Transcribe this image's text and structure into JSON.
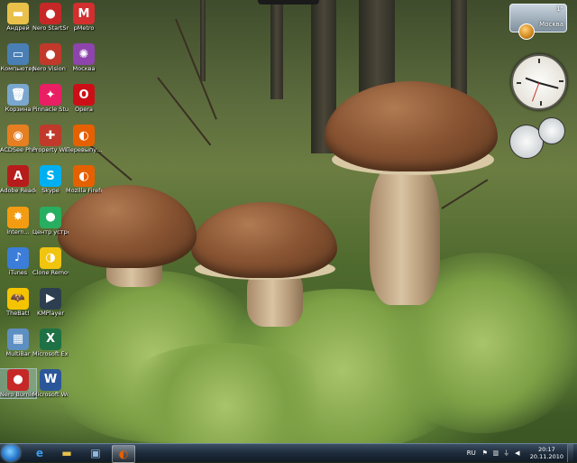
{
  "desktop_icons": [
    {
      "label": "Андрей",
      "icon": "folder-icon",
      "color": "#e8c04a",
      "glyph": "▬"
    },
    {
      "label": "Nero StartSmart 10",
      "icon": "nero-icon",
      "color": "#c62828",
      "glyph": "●"
    },
    {
      "label": "pMetro",
      "icon": "pmetro-icon",
      "color": "#d32f2f",
      "glyph": "M"
    },
    {
      "label": "Компьютер",
      "icon": "computer-icon",
      "color": "#4a7fb5",
      "glyph": "▭"
    },
    {
      "label": "Nero Vision 10",
      "icon": "nero-vision-icon",
      "color": "#c0392b",
      "glyph": "●"
    },
    {
      "label": "Москва",
      "icon": "moscow-icon",
      "color": "#8e44ad",
      "glyph": "✺"
    },
    {
      "label": "Корзина",
      "icon": "recycle-bin-icon",
      "color": "#7aa7cf",
      "glyph": "🗑"
    },
    {
      "label": "Pinnacle Studio 14",
      "icon": "pinnacle-icon",
      "color": "#e91e63",
      "glyph": "✦"
    },
    {
      "label": "Opera",
      "icon": "opera-icon",
      "color": "#cc0f16",
      "glyph": "O"
    },
    {
      "label": "ACDSee Photo Ma...",
      "icon": "acdsee-icon",
      "color": "#e67e22",
      "glyph": "◉"
    },
    {
      "label": "Property Wizard",
      "icon": "wizard-icon",
      "color": "#c0392b",
      "glyph": "✚"
    },
    {
      "label": "Перевыпу...",
      "icon": "firefox-icon",
      "color": "#e66000",
      "glyph": "◐"
    },
    {
      "label": "Adobe Reader X",
      "icon": "adobe-reader-icon",
      "color": "#b71c1c",
      "glyph": "A"
    },
    {
      "label": "Skype",
      "icon": "skype-icon",
      "color": "#00aff0",
      "glyph": "S"
    },
    {
      "label": "Mozilla Firefox",
      "icon": "firefox-icon",
      "color": "#e66000",
      "glyph": "◐"
    },
    {
      "label": "Intern...",
      "icon": "internet-icon",
      "color": "#f39c12",
      "glyph": "✸"
    },
    {
      "label": "Центр устройст...",
      "icon": "device-center-icon",
      "color": "#27ae60",
      "glyph": "●"
    },
    {
      "label": "iTunes",
      "icon": "itunes-icon",
      "color": "#3b7dd8",
      "glyph": "♪"
    },
    {
      "label": "Clone Remover 3.9",
      "icon": "clone-remover-icon",
      "color": "#f1c40f",
      "glyph": "◑"
    },
    {
      "label": "TheBat!",
      "icon": "thebat-icon",
      "color": "#f5c400",
      "glyph": "🦇"
    },
    {
      "label": "KMPlayer",
      "icon": "kmplayer-icon",
      "color": "#2c3e50",
      "glyph": "▶"
    },
    {
      "label": "MultiBar",
      "icon": "multibar-icon",
      "color": "#5d8fc2",
      "glyph": "▦"
    },
    {
      "label": "Microsoft Excel 2010",
      "icon": "excel-icon",
      "color": "#1e7145",
      "glyph": "X"
    },
    {
      "label": "Nero Burning ROM 10",
      "icon": "nero-burning-icon",
      "color": "#c62828",
      "glyph": "●"
    },
    {
      "label": "Microsoft Word 2010",
      "icon": "word-icon",
      "color": "#2b579a",
      "glyph": "W"
    }
  ],
  "weather": {
    "city": "Москва",
    "temp": "1°"
  },
  "taskbar": {
    "pinned": [
      {
        "icon": "internet-explorer-icon",
        "glyph": "e",
        "color": "#3d9ae8"
      },
      {
        "icon": "explorer-folder-icon",
        "glyph": "▬",
        "color": "#e8c04a"
      },
      {
        "icon": "switch-windows-icon",
        "glyph": "▣",
        "color": "#8fb8e0"
      },
      {
        "icon": "firefox-icon",
        "glyph": "◐",
        "color": "#e66000"
      }
    ],
    "language": "RU",
    "time": "20:17",
    "date": "20.11.2010"
  }
}
